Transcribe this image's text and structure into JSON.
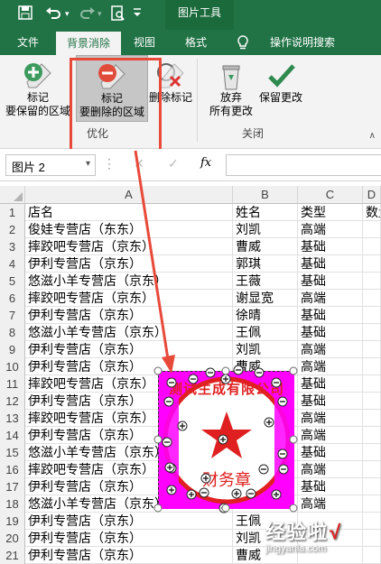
{
  "title_bar": {
    "contextual_tab": "图片工具"
  },
  "tabs": [
    "文件",
    "背景消除",
    "视图",
    "格式"
  ],
  "tell_me": "操作说明搜索",
  "ribbon": {
    "keep": [
      "标记",
      "要保留的区域"
    ],
    "remove": [
      "标记",
      "要删除的区域"
    ],
    "delete_mark": "删除标记",
    "discard": [
      "放弃",
      "所有更改"
    ],
    "save": "保留更改",
    "group_optimize": "优化",
    "group_close": "关闭"
  },
  "name_box": "图片 2",
  "formula_fx": "fx",
  "col_headers": [
    "A",
    "B",
    "C",
    "D"
  ],
  "rows": [
    {
      "n": "1",
      "a": "店名",
      "b": "姓名",
      "c": "类型",
      "d": "数量"
    },
    {
      "n": "2",
      "a": "俊娃专营店（东东）",
      "b": "刘凯",
      "c": "高端",
      "d": ""
    },
    {
      "n": "3",
      "a": "摔跤吧专营店（京东）",
      "b": "曹威",
      "c": "基础",
      "d": ""
    },
    {
      "n": "4",
      "a": "伊利专营店（京东）",
      "b": "郭琪",
      "c": "基础",
      "d": ""
    },
    {
      "n": "5",
      "a": "悠滋小羊专营店（京东）",
      "b": "王薇",
      "c": "基础",
      "d": ""
    },
    {
      "n": "6",
      "a": "摔跤吧专营店（京东）",
      "b": "谢显宽",
      "c": "高端",
      "d": ""
    },
    {
      "n": "7",
      "a": "伊利专营店（京东）",
      "b": "徐晴",
      "c": "基础",
      "d": ""
    },
    {
      "n": "8",
      "a": "悠滋小羊专营店（京东）",
      "b": "王佩",
      "c": "基础",
      "d": ""
    },
    {
      "n": "9",
      "a": "伊利专营店（京东）",
      "b": "刘凯",
      "c": "高端",
      "d": ""
    },
    {
      "n": "10",
      "a": "伊利专营店（京东）",
      "b": "曹威",
      "c": "高端",
      "d": ""
    },
    {
      "n": "11",
      "a": "摔跤吧专营店（京东）",
      "b": "",
      "c": "基础",
      "d": ""
    },
    {
      "n": "12",
      "a": "伊利专营店（京东）",
      "b": "",
      "c": "基础",
      "d": ""
    },
    {
      "n": "13",
      "a": "摔跤吧专营店（京东）",
      "b": "",
      "c": "高端",
      "d": ""
    },
    {
      "n": "14",
      "a": "伊利专营店（京东）",
      "b": "",
      "c": "高端",
      "d": ""
    },
    {
      "n": "15",
      "a": "悠滋小羊专营店（京东）",
      "b": "",
      "c": "基础",
      "d": ""
    },
    {
      "n": "16",
      "a": "摔跤吧专营店（京东）",
      "b": "",
      "c": "高端",
      "d": ""
    },
    {
      "n": "17",
      "a": "伊利专营店（京东）",
      "b": "",
      "c": "基础",
      "d": ""
    },
    {
      "n": "18",
      "a": "悠滋小羊专营店（京东）",
      "b": "",
      "c": "高端",
      "d": ""
    },
    {
      "n": "19",
      "a": "伊利专营店（京东）",
      "b": "王佩",
      "c": "",
      "d": ""
    },
    {
      "n": "20",
      "a": "伊利专营店（京东）",
      "b": "刘凯",
      "c": "",
      "d": ""
    },
    {
      "n": "21",
      "a": "伊利专营店（京东）",
      "b": "曹威",
      "c": "",
      "d": ""
    }
  ],
  "stamp": {
    "ring_text": "测试生成有限公司",
    "center_text": "财务章"
  },
  "watermark": "经验啦",
  "watermark_url": "jingyanla.com",
  "colors": {
    "accent": "#217346",
    "highlight_box": "#e84a3a",
    "stamp": "#e02020",
    "removed_area": "#ff00ff"
  }
}
